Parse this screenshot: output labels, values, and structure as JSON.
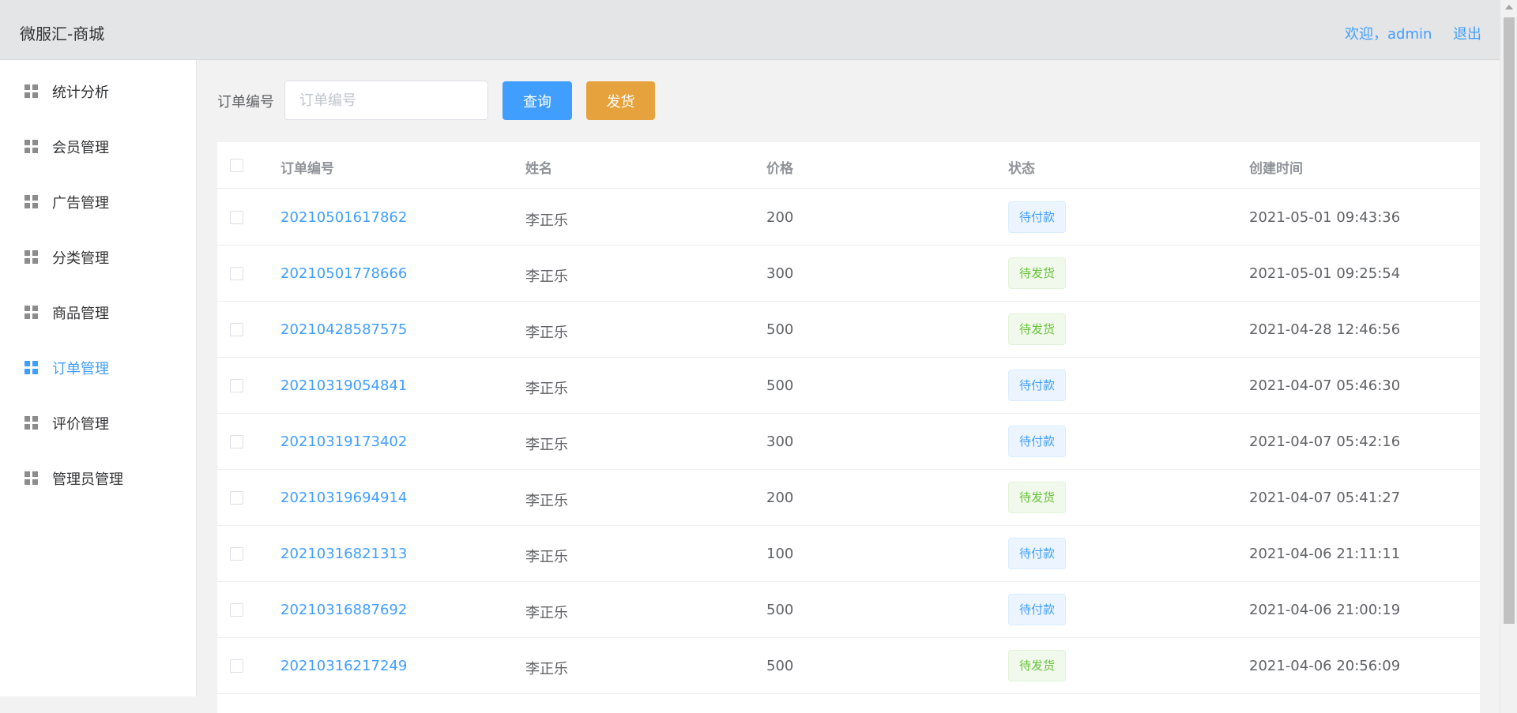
{
  "header": {
    "brand": "微服汇-商城",
    "welcome": "欢迎，admin",
    "logout": "退出"
  },
  "sidebar": {
    "items": [
      {
        "label": "统计分析"
      },
      {
        "label": "会员管理"
      },
      {
        "label": "广告管理"
      },
      {
        "label": "分类管理"
      },
      {
        "label": "商品管理"
      },
      {
        "label": "订单管理",
        "active": true
      },
      {
        "label": "评价管理"
      },
      {
        "label": "管理员管理"
      }
    ]
  },
  "search": {
    "label": "订单编号",
    "placeholder": "订单编号",
    "value": "",
    "query_button": "查询",
    "ship_button": "发货"
  },
  "table": {
    "columns": [
      "订单编号",
      "姓名",
      "价格",
      "状态",
      "创建时间"
    ],
    "rows": [
      {
        "order_no": "20210501617862",
        "name": "李正乐",
        "price": "200",
        "status": "待付款",
        "created": "2021-05-01 09:43:36"
      },
      {
        "order_no": "20210501778666",
        "name": "李正乐",
        "price": "300",
        "status": "待发货",
        "created": "2021-05-01 09:25:54"
      },
      {
        "order_no": "20210428587575",
        "name": "李正乐",
        "price": "500",
        "status": "待发货",
        "created": "2021-04-28 12:46:56"
      },
      {
        "order_no": "20210319054841",
        "name": "李正乐",
        "price": "500",
        "status": "待付款",
        "created": "2021-04-07 05:46:30"
      },
      {
        "order_no": "20210319173402",
        "name": "李正乐",
        "price": "300",
        "status": "待付款",
        "created": "2021-04-07 05:42:16"
      },
      {
        "order_no": "20210319694914",
        "name": "李正乐",
        "price": "200",
        "status": "待发货",
        "created": "2021-04-07 05:41:27"
      },
      {
        "order_no": "20210316821313",
        "name": "李正乐",
        "price": "100",
        "status": "待付款",
        "created": "2021-04-06 21:11:11"
      },
      {
        "order_no": "20210316887692",
        "name": "李正乐",
        "price": "500",
        "status": "待付款",
        "created": "2021-04-06 21:00:19"
      },
      {
        "order_no": "20210316217249",
        "name": "李正乐",
        "price": "500",
        "status": "待发货",
        "created": "2021-04-06 20:56:09"
      }
    ]
  },
  "colors": {
    "primary": "#409eff",
    "warning": "#e6a23c",
    "success": "#67c23a",
    "header_bg": "#e4e5e7"
  },
  "icons": {
    "nav": "grid-icon"
  }
}
